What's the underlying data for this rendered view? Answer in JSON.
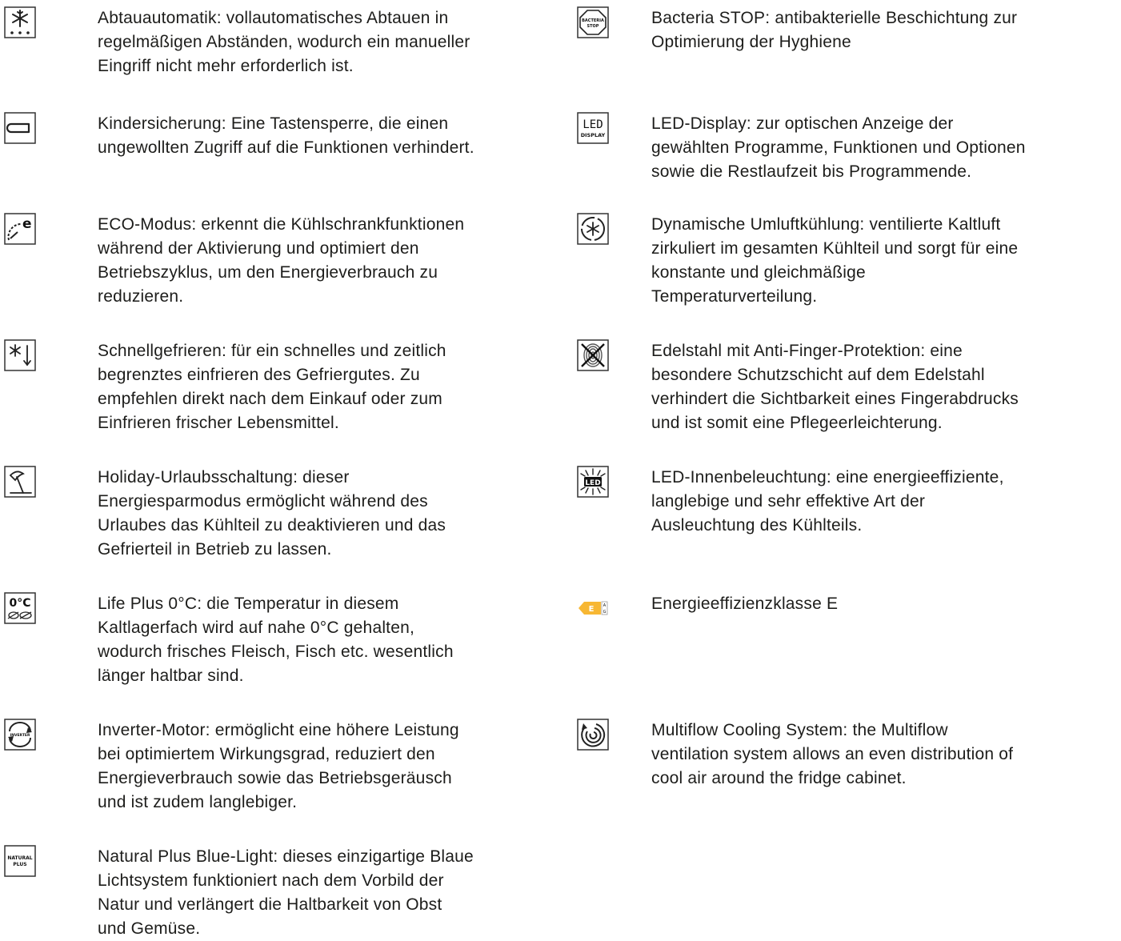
{
  "left_column": [
    {
      "icon": "auto-defrost-icon",
      "text": "Abtauautomatik: vollautomatisches Abtauen in\nregelmäßigen Abständen, wodurch ein manueller\nEingriff nicht mehr erforderlich ist."
    },
    {
      "icon": "child-lock-icon",
      "text": "Kindersicherung: Eine Tastensperre, die einen\nungewollten Zugriff auf die Funktionen verhindert."
    },
    {
      "icon": "eco-mode-icon",
      "text": "ECO-Modus: erkennt die Kühlschrankfunktionen\nwährend der Aktivierung und optimiert den\nBetriebszyklus, um den Energieverbrauch zu\nreduzieren."
    },
    {
      "icon": "fast-freeze-icon",
      "text": "Schnellgefrieren: für ein schnelles und zeitlich\nbegrenztes einfrieren des Gefriergutes. Zu\nempfehlen direkt nach dem Einkauf oder zum\nEinfrieren frischer Lebensmittel."
    },
    {
      "icon": "holiday-mode-icon",
      "text": "Holiday-Urlaubsschaltung: dieser\nEnergiesparmodus ermöglicht während des\nUrlaubes das Kühlteil zu deaktivieren und das\nGefrierteil in Betrieb zu lassen."
    },
    {
      "icon": "life-plus-0c-icon",
      "icon_text": "0°C",
      "text": "Life Plus 0°C: die Temperatur in diesem\nKaltlagerfach wird auf nahe 0°C gehalten,\nwodurch frisches Fleisch, Fisch etc. wesentlich\nlänger haltbar sind."
    },
    {
      "icon": "inverter-motor-icon",
      "icon_text": "INVERTER",
      "text": "Inverter-Motor: ermöglicht eine höhere Leistung\nbei optimiertem Wirkungsgrad, reduziert den\nEnergieverbrauch sowie das Betriebsgeräusch\nund ist zudem langlebiger."
    },
    {
      "icon": "natural-plus-icon",
      "icon_text": "NATURAL PLUS",
      "text": "Natural Plus Blue-Light: dieses einzigartige Blaue\nLichtsystem funktioniert nach dem Vorbild der\nNatur und verlängert die Haltbarkeit von Obst\nund Gemüse."
    }
  ],
  "right_column": [
    {
      "icon": "bacteria-stop-icon",
      "icon_text": "BACTERIA STOP",
      "text": "Bacteria STOP: antibakterielle Beschichtung zur\nOptimierung der Hyghiene"
    },
    {
      "icon": "led-display-icon",
      "icon_text": "LED DISPLAY",
      "text": "LED-Display: zur optischen Anzeige der\ngewählten Programme, Funktionen und Optionen\nsowie die Restlaufzeit bis Programmende."
    },
    {
      "icon": "dynamic-cooling-icon",
      "text": "Dynamische Umluftkühlung: ventilierte Kaltluft\nzirkuliert im gesamten Kühlteil und sorgt für eine\nkonstante und gleichmäßige\nTemperaturverteilung."
    },
    {
      "icon": "anti-fingerprint-icon",
      "text": "Edelstahl mit Anti-Finger-Protektion: eine\nbesondere Schutzschicht auf dem Edelstahl\nverhindert die Sichtbarkeit eines Fingerabdrucks\nund ist somit eine Pflegeerleichterung."
    },
    {
      "icon": "led-lighting-icon",
      "icon_text": "LED",
      "text": "LED-Innenbeleuchtung: eine energieeffiziente,\nlanglebige und sehr effektive Art der\nAusleuchtung des Kühlteils."
    },
    {
      "icon": "energy-class-icon",
      "icon_text": "E",
      "energy_class": "E",
      "energy_color": "#f7b733",
      "text": "Energieeffizienzklasse E"
    },
    {
      "icon": "multiflow-icon",
      "text": "Multiflow Cooling System: the Multiflow\nventilation system allows an even distribution of\ncool air around the fridge cabinet."
    }
  ]
}
